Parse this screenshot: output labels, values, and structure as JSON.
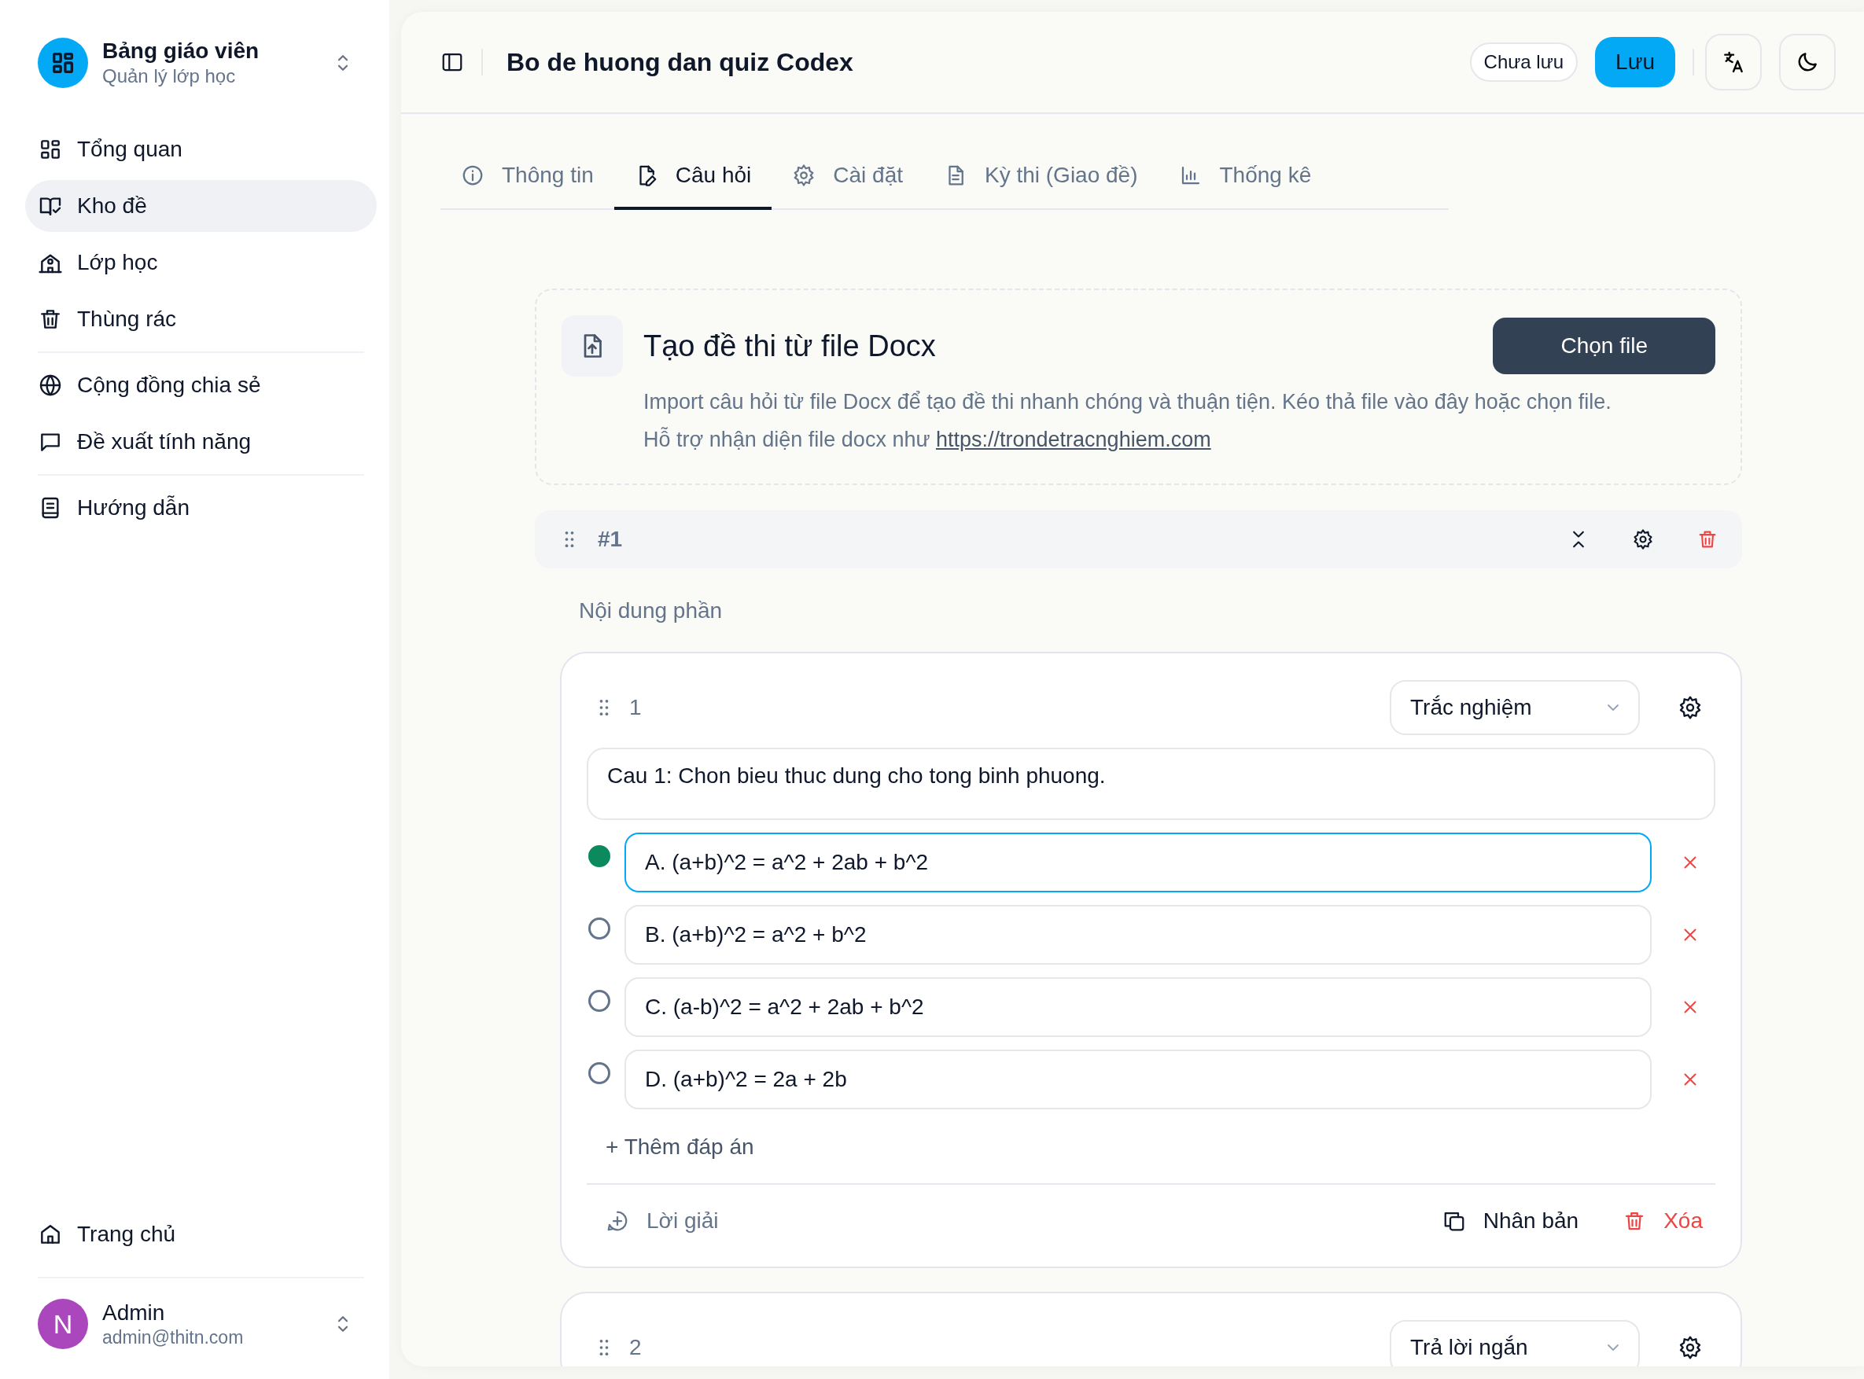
{
  "sidebar": {
    "brand": {
      "title": "Bảng giáo viên",
      "subtitle": "Quản lý lớp học"
    },
    "nav_groups": [
      [
        {
          "label": "Tổng quan",
          "selected": false
        },
        {
          "label": "Kho đề",
          "selected": true
        },
        {
          "label": "Lớp học",
          "selected": false
        },
        {
          "label": "Thùng rác",
          "selected": false
        }
      ],
      [
        {
          "label": "Cộng đồng chia sẻ",
          "selected": false
        },
        {
          "label": "Đề xuất tính năng",
          "selected": false
        }
      ],
      [
        {
          "label": "Hướng dẫn",
          "selected": false
        }
      ]
    ],
    "footer_items": [
      {
        "label": "Trang chủ",
        "selected": false
      }
    ],
    "user": {
      "initial": "N",
      "name": "Admin",
      "email": "admin@thitn.com"
    }
  },
  "header": {
    "title": "Bo de huong dan quiz Codex",
    "save_status": "Chưa lưu",
    "save_button": "Lưu"
  },
  "tabs": [
    {
      "label": "Thông tin",
      "selected": false
    },
    {
      "label": "Câu hỏi",
      "selected": true
    },
    {
      "label": "Cài đặt",
      "selected": false
    },
    {
      "label": "Kỳ thi (Giao đề)",
      "selected": false
    },
    {
      "label": "Thống kê",
      "selected": false
    }
  ],
  "import_card": {
    "title": "Tạo đề thi từ file Docx",
    "button": "Chọn file",
    "description": "Import câu hỏi từ file Docx để tạo đề thi nhanh chóng và thuận tiện. Kéo thả file vào đây hoặc chọn file.",
    "support_text": "Hỗ trợ nhận diện file docx như ",
    "link": "https://trondetracnghiem.com"
  },
  "section": {
    "number": "#1",
    "placeholder": "Nội dung phần"
  },
  "questions": [
    {
      "number": "1",
      "type": "Trắc nghiệm",
      "text": "Cau 1: Chon bieu thuc dung cho tong binh phuong.",
      "options": [
        {
          "text": "A. (a+b)^2 = a^2 + 2ab + b^2",
          "correct": true,
          "focused": true
        },
        {
          "text": "B. (a+b)^2 = a^2 + b^2",
          "correct": false,
          "focused": false
        },
        {
          "text": "C. (a-b)^2 = a^2 + 2ab + b^2",
          "correct": false,
          "focused": false
        },
        {
          "text": "D. (a+b)^2 = 2a + 2b",
          "correct": false,
          "focused": false
        }
      ],
      "add_option": "+ Thêm đáp án",
      "solution": "Lời giải",
      "duplicate": "Nhân bản",
      "delete": "Xóa"
    },
    {
      "number": "2",
      "type": "Trả lời ngắn"
    }
  ]
}
